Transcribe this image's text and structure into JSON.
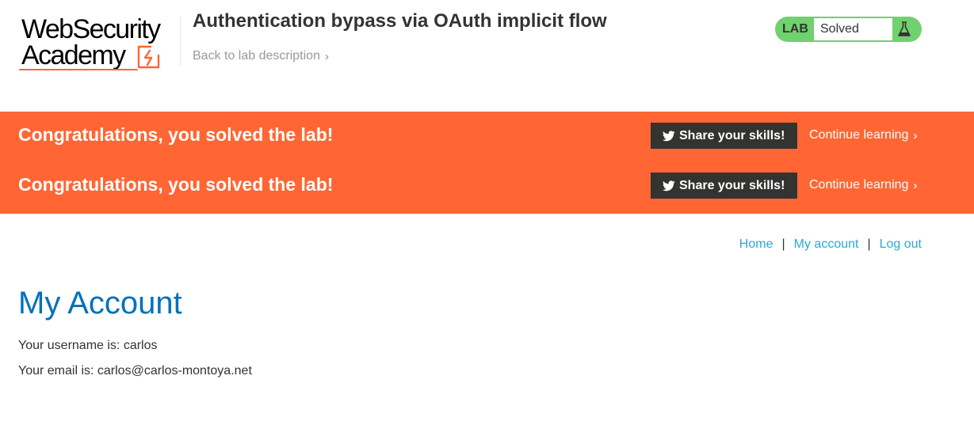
{
  "header": {
    "logo": {
      "line1": "WebSecurity",
      "line2": "Academy"
    },
    "lab_title": "Authentication bypass via OAuth implicit flow",
    "back_link": "Back to lab description",
    "status": {
      "label": "LAB",
      "value": "Solved",
      "icon": "flask-icon",
      "color": "#70d16d"
    }
  },
  "banner": {
    "color": "#ff6633",
    "rows": [
      {
        "message": "Congratulations, you solved the lab!",
        "share_label": "Share your skills!",
        "continue_label": "Continue learning"
      },
      {
        "message": "Congratulations, you solved the lab!",
        "share_label": "Share your skills!",
        "continue_label": "Continue learning"
      }
    ]
  },
  "nav": {
    "home": "Home",
    "my_account": "My account",
    "log_out": "Log out",
    "separator": "|"
  },
  "account": {
    "heading": "My Account",
    "username_line": "Your username is: carlos",
    "email_line": "Your email is: carlos@carlos-montoya.net"
  }
}
